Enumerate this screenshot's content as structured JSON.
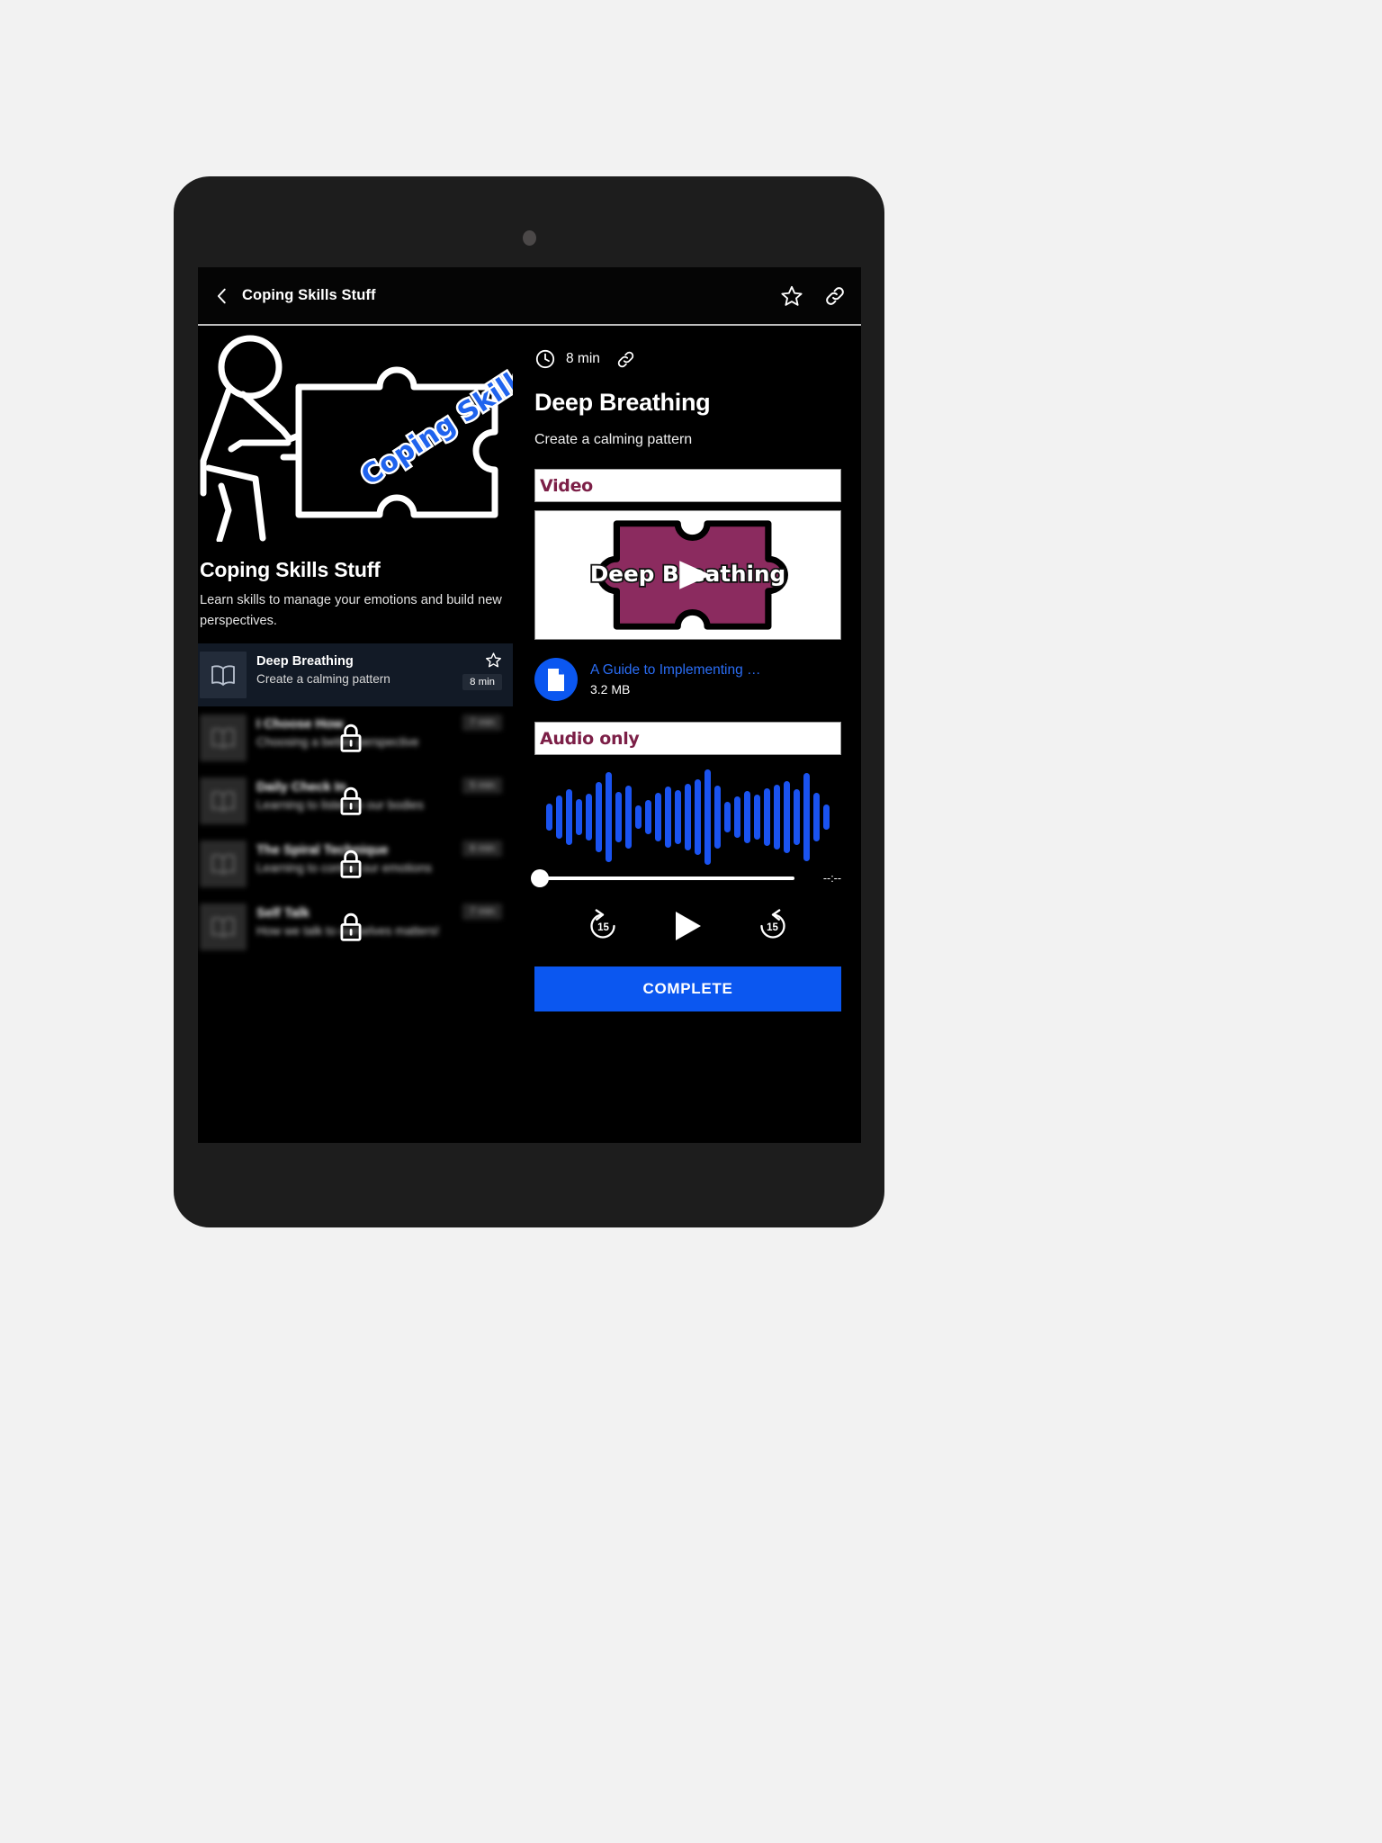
{
  "app_bar": {
    "title": "Coping Skills Stuff",
    "back_icon": "chevron-left-icon",
    "favorite_icon": "star-outline-icon",
    "share_icon": "link-icon"
  },
  "course": {
    "hero_caption": "Coping Skills",
    "title": "Coping Skills Stuff",
    "description": "Learn skills to manage your emotions and build new perspectives.",
    "lessons": [
      {
        "title": "Deep Breathing",
        "subtitle": "Create a calming pattern",
        "duration": "8 min",
        "locked": false,
        "selected": true,
        "icon": "book-icon",
        "star_icon": "star-outline-icon"
      },
      {
        "title": "I Choose How",
        "subtitle": "Choosing a better perspective",
        "duration": "7 min",
        "locked": true,
        "selected": false,
        "icon": "book-icon",
        "lock_icon": "lock-icon"
      },
      {
        "title": "Daily Check In",
        "subtitle": "Learning to listen to our bodies",
        "duration": "5 min",
        "locked": true,
        "selected": false,
        "icon": "book-icon",
        "lock_icon": "lock-icon"
      },
      {
        "title": "The Spiral Technique",
        "subtitle": "Learning to control our emotions",
        "duration": "6 min",
        "locked": true,
        "selected": false,
        "icon": "book-icon",
        "lock_icon": "lock-icon"
      },
      {
        "title": "Self Talk",
        "subtitle": "How we talk to ourselves matters!",
        "duration": "7 min",
        "locked": true,
        "selected": false,
        "icon": "book-icon",
        "lock_icon": "lock-icon"
      }
    ]
  },
  "detail": {
    "duration": "8 min",
    "clock_icon": "clock-icon",
    "share_icon": "link-icon",
    "title": "Deep Breathing",
    "subtitle": "Create a calming pattern",
    "video_section_label": "Video",
    "video_thumb_caption": "Deep Breathing",
    "play_overlay_icon": "play-icon",
    "attachment": {
      "icon": "document-icon",
      "name": "A Guide to Implementing …",
      "size": "3.2 MB"
    },
    "audio_section_label": "Audio only",
    "player": {
      "time_label": "--:--",
      "progress_percent": 0,
      "rewind_label": "15",
      "forward_label": "15",
      "rewind_icon": "replay-15-icon",
      "play_icon": "play-icon",
      "forward_icon": "forward-15-icon",
      "waveform_heights": [
        30,
        48,
        62,
        40,
        52,
        78,
        100,
        56,
        70,
        26,
        38,
        54,
        68,
        60,
        74,
        84,
        106,
        70,
        34,
        46,
        58,
        50,
        64,
        72,
        80,
        62,
        98,
        54,
        28
      ]
    },
    "complete_label": "COMPLETE"
  },
  "colors": {
    "accent_blue": "#0b57f0",
    "section_maroon": "#7c1f47",
    "puzzle_maroon": "#8b2b5f",
    "waveform_blue": "#1a53f0",
    "selected_row": "#121a26"
  }
}
